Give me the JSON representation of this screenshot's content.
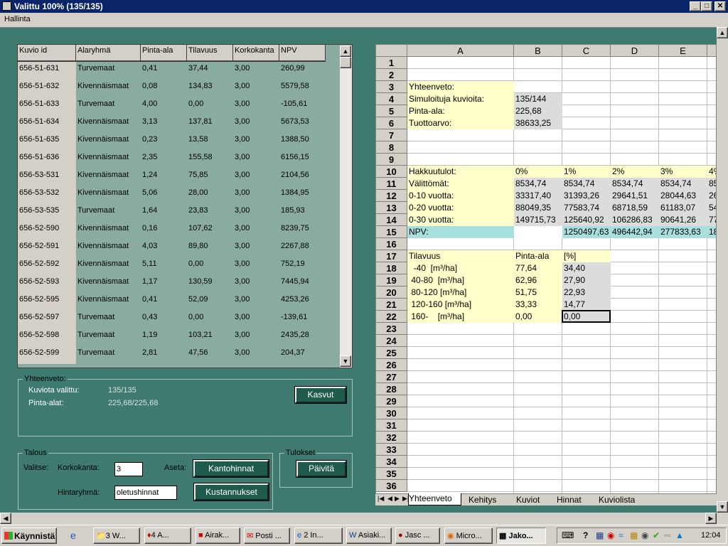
{
  "window": {
    "title": "Valittu 100% (135/135)",
    "menu": "Hallinta"
  },
  "grid": {
    "headers": [
      "Kuvio id",
      "Alaryhmä",
      "Pinta-ala",
      "Tilavuus",
      "Korkokanta",
      "NPV"
    ],
    "rows": [
      [
        "656-51-631",
        "Turvemaat",
        "0,41",
        "37,44",
        "3,00",
        "260,99"
      ],
      [
        "656-51-632",
        "Kivennäismaat",
        "0,08",
        "134,83",
        "3,00",
        "5579,58"
      ],
      [
        "656-51-633",
        "Turvemaat",
        "4,00",
        "0,00",
        "3,00",
        "-105,61"
      ],
      [
        "656-51-634",
        "Kivennäismaat",
        "3,13",
        "137,81",
        "3,00",
        "5673,53"
      ],
      [
        "656-51-635",
        "Kivennäismaat",
        "0,23",
        "13,58",
        "3,00",
        "1388,50"
      ],
      [
        "656-51-636",
        "Kivennäismaat",
        "2,35",
        "155,58",
        "3,00",
        "6156,15"
      ],
      [
        "656-53-531",
        "Kivennäismaat",
        "1,24",
        "75,85",
        "3,00",
        "2104,56"
      ],
      [
        "656-53-532",
        "Kivennäismaat",
        "5,06",
        "28,00",
        "3,00",
        "1384,95"
      ],
      [
        "656-53-535",
        "Turvemaat",
        "1,64",
        "23,83",
        "3,00",
        "185,93"
      ],
      [
        "656-52-590",
        "Kivennäismaat",
        "0,16",
        "107,62",
        "3,00",
        "8239,75"
      ],
      [
        "656-52-591",
        "Kivennäismaat",
        "4,03",
        "89,80",
        "3,00",
        "2267,88"
      ],
      [
        "656-52-592",
        "Kivennäismaat",
        "5,11",
        "0,00",
        "3,00",
        "752,19"
      ],
      [
        "656-52-593",
        "Kivennäismaat",
        "1,17",
        "130,59",
        "3,00",
        "7445,94"
      ],
      [
        "656-52-595",
        "Kivennäismaat",
        "0,41",
        "52,09",
        "3,00",
        "4253,26"
      ],
      [
        "656-52-597",
        "Turvemaat",
        "0,43",
        "0,00",
        "3,00",
        "-139,61"
      ],
      [
        "656-52-598",
        "Turvemaat",
        "1,19",
        "103,21",
        "3,00",
        "2435,28"
      ],
      [
        "656-52-599",
        "Turvemaat",
        "2,81",
        "47,56",
        "3,00",
        "204,37"
      ]
    ]
  },
  "summary": {
    "title": "Yhteenveto:",
    "selected_label": "Kuviota valittu:",
    "selected_value": "135/135",
    "area_label": "Pinta-alat:",
    "area_value": "225,68/225,68",
    "growth_button": "Kasvut"
  },
  "talous": {
    "title": "Talous",
    "select_label": "Valitse:",
    "rate_label": "Korkokanta:",
    "rate_value": "3",
    "set_label": "Aseta:",
    "stump_button": "Kantohinnat",
    "price_group_label": "Hintaryhmä:",
    "price_group_value": "oletushinnat",
    "cost_button": "Kustannukset"
  },
  "tulokset": {
    "title": "Tulokset",
    "update_button": "Päivitä"
  },
  "sheet": {
    "columns": [
      "A",
      "B",
      "C",
      "D",
      "E"
    ],
    "rows": [
      "1",
      "2",
      "3",
      "4",
      "5",
      "6",
      "7",
      "8",
      "9",
      "10",
      "11",
      "12",
      "13",
      "14",
      "15",
      "16",
      "17",
      "18",
      "19",
      "20",
      "21",
      "22",
      "23",
      "24",
      "25",
      "26",
      "27",
      "28",
      "29",
      "30",
      "31",
      "32",
      "33",
      "34",
      "35",
      "36"
    ],
    "cells": {
      "r3": [
        "Yhteenveto:",
        "",
        "",
        "",
        "",
        ""
      ],
      "r4": [
        "Simuloituja kuvioita:",
        "135/144",
        "",
        "",
        "",
        ""
      ],
      "r5": [
        "Pinta-ala:",
        "225,68",
        "",
        "",
        "",
        ""
      ],
      "r6": [
        "Tuottoarvo:",
        "38633,25",
        "",
        "",
        "",
        ""
      ],
      "r10": [
        "Hakkuutulot:",
        "0%",
        "1%",
        "2%",
        "3%",
        "4%"
      ],
      "r11": [
        "Välittömät:",
        "8534,74",
        "8534,74",
        "8534,74",
        "8534,74",
        "85"
      ],
      "r12": [
        "0-10 vuotta:",
        "33317,40",
        "31393,26",
        "29641,51",
        "28044,63",
        "26"
      ],
      "r13": [
        "0-20 vuotta:",
        "88049,35",
        "77583,74",
        "68718,59",
        "61183,07",
        "54"
      ],
      "r14": [
        "0-30 vuotta:",
        "149715,73",
        "125640,92",
        "106286,83",
        "90641,26",
        "77"
      ],
      "r15": [
        "NPV:",
        "",
        "1250497,63",
        "496442,94",
        "277833,63",
        "18"
      ],
      "r17": [
        "Tilavuus",
        "Pinta-ala",
        "[%]",
        "",
        "",
        ""
      ],
      "r18": [
        "  -40  [m³/ha]",
        "77,64",
        "34,40",
        "",
        "",
        ""
      ],
      "r19": [
        " 40-80  [m³/ha]",
        "62,96",
        "27,90",
        "",
        "",
        ""
      ],
      "r20": [
        " 80-120 [m³/ha]",
        "51,75",
        "22,93",
        "",
        "",
        ""
      ],
      "r21": [
        " 120-160 [m³/ha]",
        "33,33",
        "14,77",
        "",
        "",
        ""
      ],
      "r22": [
        " 160-    [m³/ha]",
        "0,00",
        "0,00",
        "",
        "",
        ""
      ]
    },
    "tabs": [
      "Yhteenveto",
      "Kehitys",
      "Kuviot",
      "Hinnat",
      "Kuviolista"
    ]
  },
  "taskbar": {
    "start": "Käynnistä",
    "items": [
      "3 W...",
      "4 A...",
      "Airak...",
      "Posti ...",
      "2 In...",
      "Asiaki...",
      "Jasc ...",
      "Micro...",
      "Jako..."
    ],
    "clock": "12:04"
  }
}
